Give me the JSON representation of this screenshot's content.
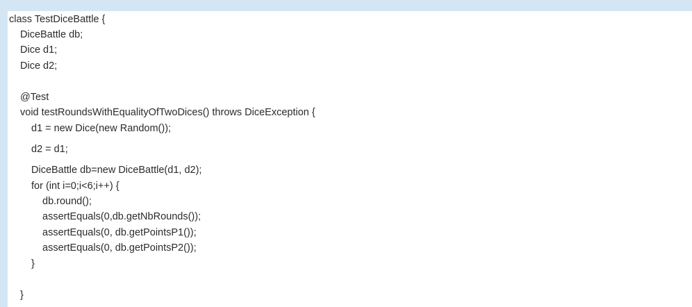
{
  "code": {
    "lines": [
      "class TestDiceBattle {",
      "DiceBattle db;",
      "Dice d1;",
      "Dice d2;",
      "",
      "@Test",
      "void testRoundsWithEqualityOfTwoDices() throws DiceException {",
      "d1 = new Dice(new Random());",
      "d2 = d1;",
      "DiceBattle db=new DiceBattle(d1, d2);",
      "for (int i=0;i<6;i++) {",
      "db.round();",
      "assertEquals(0,db.getNbRounds());",
      "assertEquals(0, db.getPointsP1());",
      "assertEquals(0, db.getPointsP2());",
      "}",
      "",
      "}"
    ]
  }
}
